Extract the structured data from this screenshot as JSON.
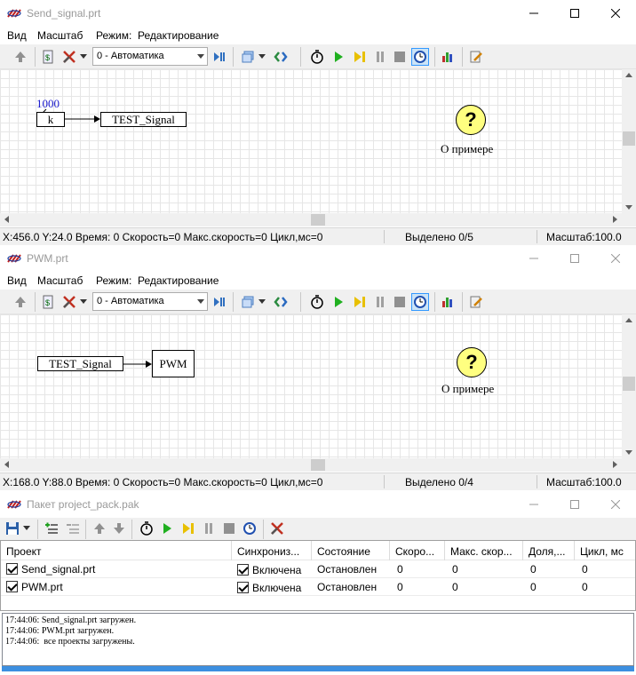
{
  "windows": [
    {
      "title": "Send_signal.prt",
      "menu": [
        "Вид",
        "Масштаб",
        "Режим:",
        "Редактирование"
      ],
      "mode_combo": "0 - Автоматика",
      "blocks": {
        "const_value": "1000",
        "const_label": "k",
        "signal_label": "TEST_Signal"
      },
      "help_label": "О примере",
      "status": {
        "coords": "X:456.0  Y:24.0 Время: 0 Скорость=0 Макс.скорость=0 Цикл,мс=0",
        "selected": "Выделено 0/5",
        "scale": "Масштаб:100.0"
      }
    },
    {
      "title": "PWM.prt",
      "menu": [
        "Вид",
        "Масштаб",
        "Режим:",
        "Редактирование"
      ],
      "mode_combo": "0 - Автоматика",
      "blocks": {
        "signal_label": "TEST_Signal",
        "pwm_label": "PWM"
      },
      "help_label": "О примере",
      "status": {
        "coords": "X:168.0  Y:88.0 Время: 0 Скорость=0 Макс.скорость=0 Цикл,мс=0",
        "selected": "Выделено 0/4",
        "scale": "Масштаб:100.0"
      }
    }
  ],
  "package": {
    "title": "Пакет  project_pack.pak",
    "columns": [
      "Проект",
      "Синхрониз...",
      "Состояние",
      "Скоро...",
      "Макс. скор...",
      "Доля,...",
      "Цикл, мс"
    ],
    "rows": [
      {
        "project": "Send_signal.prt",
        "sync": "Включена",
        "state": "Остановлен",
        "speed": "0",
        "max_speed": "0",
        "share": "0",
        "cycle": "0"
      },
      {
        "project": "PWM.prt",
        "sync": "Включена",
        "state": "Остановлен",
        "speed": "0",
        "max_speed": "0",
        "share": "0",
        "cycle": "0"
      }
    ],
    "log": [
      "17:44:06: Send_signal.prt загружен.",
      "17:44:06: PWM.prt загружен.",
      "17:44:06:  все проекты загружены."
    ],
    "progress": 1.0
  },
  "colors": {
    "accent": "#3c8fe0",
    "help_yellow": "#ffff80",
    "grid": "#e6e6e6"
  }
}
